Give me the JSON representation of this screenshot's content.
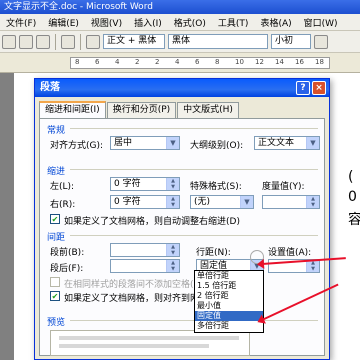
{
  "window": {
    "title": "文字显示不全.doc - Microsoft Word"
  },
  "menubar": [
    "文件(F)",
    "编辑(E)",
    "视图(V)",
    "插入(I)",
    "格式(O)",
    "工具(T)",
    "表格(A)",
    "窗口(W)"
  ],
  "toolbar": {
    "style": "正文 + 黑体",
    "font": "黑体",
    "size": "小初"
  },
  "ruler": {
    "numbers": [
      "8",
      "6",
      "4",
      "2",
      "2",
      "4",
      "6",
      "8",
      "10",
      "12",
      "14",
      "16",
      "18"
    ]
  },
  "document": {
    "char1": "(",
    "char2": "0",
    "char3": "容"
  },
  "dialog": {
    "title": "段落",
    "help": "?",
    "close": "×",
    "tabs": [
      "缩进和间距(I)",
      "换行和分页(P)",
      "中文版式(H)"
    ],
    "general": {
      "title": "常规",
      "align_label": "对齐方式(G):",
      "align_value": "居中",
      "outline_label": "大纲级别(O):",
      "outline_value": "正文文本"
    },
    "indent": {
      "title": "缩进",
      "left_label": "左(L):",
      "left_value": "0 字符",
      "right_label": "右(R):",
      "right_value": "0 字符",
      "special_label": "特殊格式(S):",
      "special_value": "(无)",
      "by_label": "度量值(Y):",
      "grid_check": "如果定义了文档网格，则自动调整右缩进(D)"
    },
    "spacing": {
      "title": "间距",
      "before_label": "段前(B):",
      "after_label": "段后(F):",
      "line_label": "行距(N):",
      "line_value": "固定值",
      "at_label": "设置值(A):",
      "same_style_check": "在相同样式的段落间不添加空格(C)",
      "snap_grid_check": "如果定义了文档网格，则对齐到网格(W)"
    },
    "preview_title": "预览"
  },
  "line_spacing_options": [
    "单倍行距",
    "1.5 倍行距",
    "2 倍行距",
    "最小值",
    "固定值",
    "多倍行距"
  ],
  "selected_option_index": 4,
  "colors": {
    "annotation_arrow": "#e8102a",
    "selection": "#316ac5",
    "title_blue": "#0a5bfd"
  }
}
